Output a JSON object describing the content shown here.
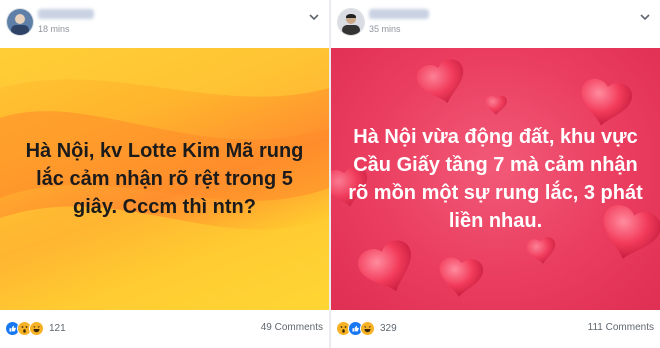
{
  "posts": [
    {
      "time": "18 mins",
      "text": "Hà Nội, kv Lotte Kim Mã rung lắc cảm nhận rõ rệt trong 5 giây. Cccm thì ntn?",
      "reaction_count": "121",
      "comments": "49 Comments",
      "reactions": [
        "like-icon",
        "wow-icon",
        "haha-icon"
      ]
    },
    {
      "time": "35 mins",
      "text": "Hà Nội vừa động đất, khu vực Cầu Giấy tầng 7 mà cảm nhận rõ mồn một sự rung lắc, 3 phát liền nhau.",
      "reaction_count": "329",
      "comments": "111 Comments",
      "reactions": [
        "wow-icon",
        "like-icon",
        "haha-icon"
      ]
    }
  ],
  "colors": {
    "left_card": "#ffb52d",
    "right_card": "#ea3d5f",
    "like": "#1877f2",
    "wow": "#f7b125",
    "meta_text": "#90949c"
  }
}
